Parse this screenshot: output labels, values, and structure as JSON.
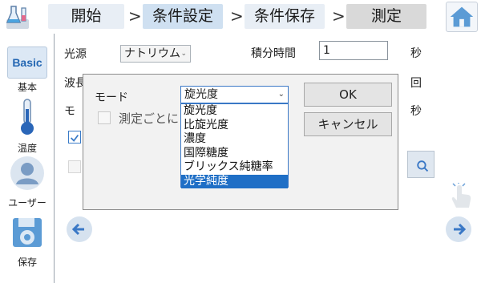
{
  "breadcrumb": {
    "steps": [
      "開始",
      "条件設定",
      "条件保存",
      "測定"
    ],
    "separator": ">"
  },
  "sidebar": {
    "items": [
      {
        "badge": "Basic",
        "label": "基本"
      },
      {
        "label": "温度"
      },
      {
        "label": "ユーザー"
      },
      {
        "label": "保存"
      }
    ]
  },
  "form": {
    "light_source_label": "光源",
    "light_source_value": "ナトリウム",
    "integration_label": "積分時間",
    "integration_value": "1",
    "integration_unit": "秒",
    "wavelength_label_partial": "波長",
    "count_unit": "回",
    "mode_label_partial": "モ",
    "interval_unit": "秒"
  },
  "dialog": {
    "mode_label": "モード",
    "selected_value": "旋光度",
    "options": [
      "旋光度",
      "比旋光度",
      "濃度",
      "国際糖度",
      "ブリックス純糖率",
      "光学純度"
    ],
    "highlighted_index": 5,
    "checkbox_label": "測定ごとに",
    "ok_label": "OK",
    "cancel_label": "キャンセル"
  },
  "colors": {
    "accent": "#1f6fc6",
    "breadcrumb_active": "#cfe0f1",
    "breadcrumb_disabled": "#d9d9d9"
  }
}
